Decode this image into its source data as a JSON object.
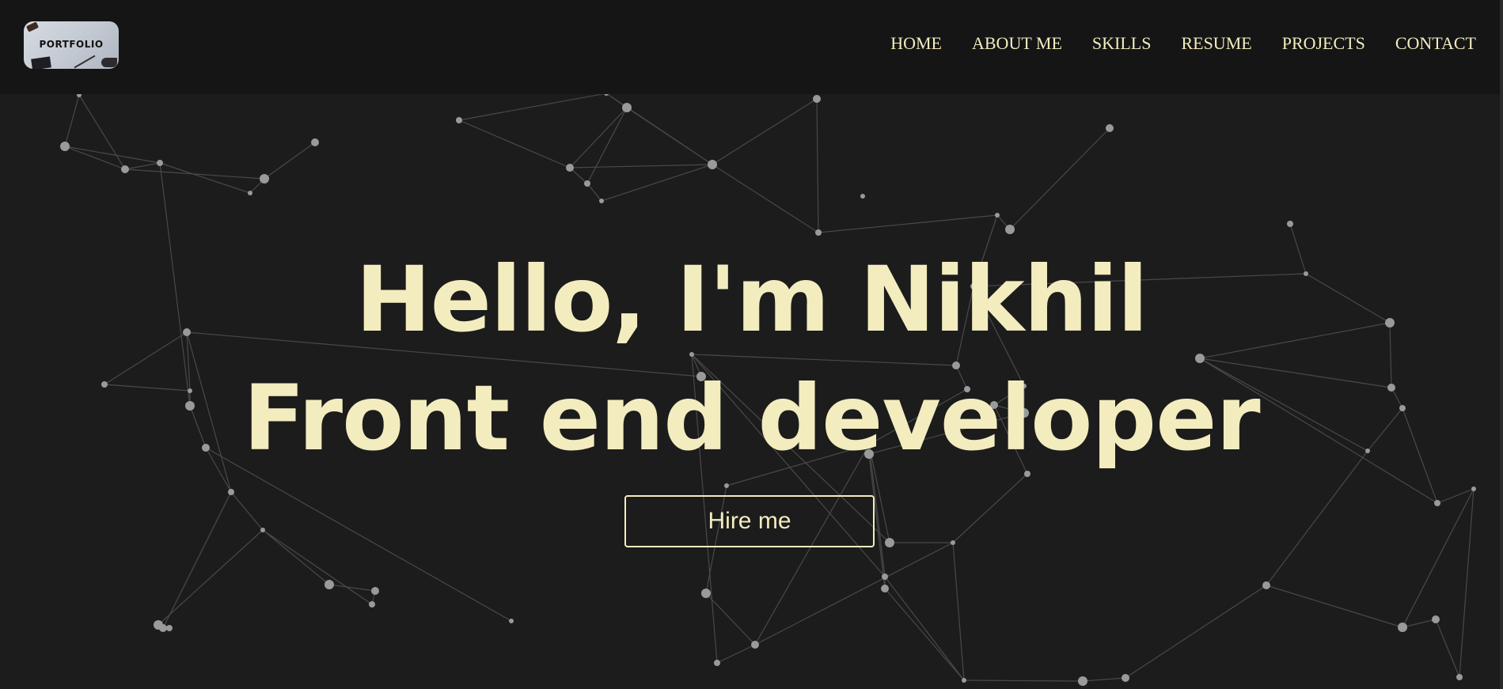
{
  "logo": {
    "text": "PORTFOLIO",
    "icon": "portfolio-logo-image"
  },
  "nav": {
    "items": [
      {
        "label": "HOME"
      },
      {
        "label": "ABOUT ME"
      },
      {
        "label": "SKILLS"
      },
      {
        "label": "RESUME"
      },
      {
        "label": "PROJECTS"
      },
      {
        "label": "CONTACT"
      }
    ]
  },
  "hero": {
    "line1": "Hello, I'm Nikhil",
    "line2": "Front end developer",
    "cta_label": "Hire me"
  },
  "colors": {
    "background": "#1c1c1c",
    "navbar": "#151515",
    "accent": "#f3ecbf",
    "particle": "#9a9a9a",
    "link_line": "#6e6e6e"
  }
}
